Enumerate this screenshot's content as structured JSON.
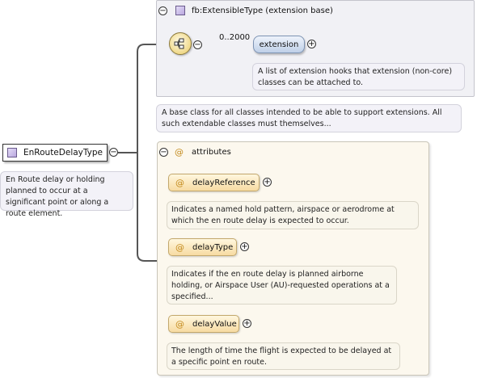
{
  "root": {
    "name": "EnRouteDelayType",
    "doc": "En Route delay or holding planned to occur at a significant point or along a route element."
  },
  "base": {
    "title": "fb:ExtensibleType (extension base)",
    "doc": "A base class for all classes intended to be able to support extensions. All such extendable classes must themselves..."
  },
  "sequence": {
    "cardinality": "0..2000",
    "element": {
      "name": "extension",
      "doc": "A list of extension hooks that extension (non-core) classes can be attached to."
    }
  },
  "attributes": {
    "title": "attributes",
    "items": [
      {
        "name": "delayReference",
        "doc": "Indicates a named hold pattern, airspace or aerodrome at which the en route delay is expected to occur."
      },
      {
        "name": "delayType",
        "doc": "Indicates if the en route delay is planned airborne holding, or Airspace User (AU)-requested operations at a specified..."
      },
      {
        "name": "delayValue",
        "doc": "The length of time the flight is expected to be delayed at a specific point en route."
      }
    ]
  },
  "symbols": {
    "at": "@",
    "collapse": "−",
    "expand": "+"
  },
  "colors": {
    "connector": "#555555",
    "base_background": "#f1f1f5",
    "attributes_background": "#fcf8ee",
    "element_pill": "#bfd0e8",
    "attribute_pill": "#f7dba2",
    "complex_type_icon": "#b9a7de"
  }
}
